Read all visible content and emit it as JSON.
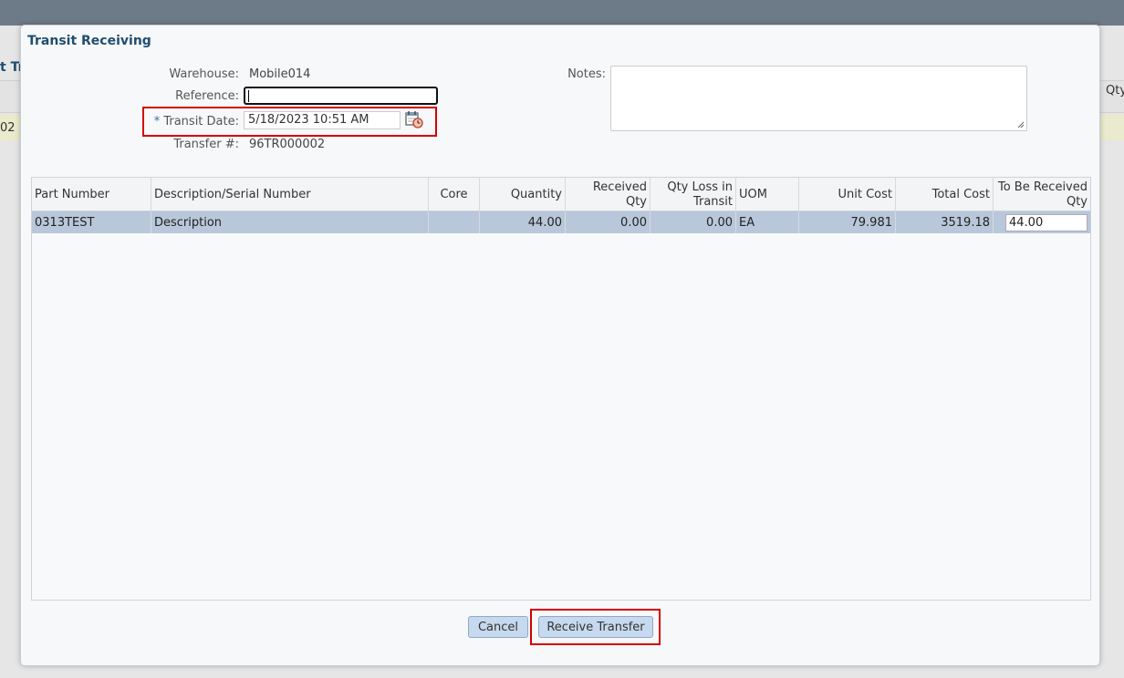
{
  "background": {
    "left_label_partial": "t Tr",
    "right_label_partial": "Qty",
    "row_partial": "02"
  },
  "dialog": {
    "title": "Transit Receiving",
    "fields": {
      "warehouse_label": "Warehouse:",
      "warehouse_value": "Mobile014",
      "reference_label": "Reference:",
      "reference_value": "",
      "transit_date_required_mark": "*",
      "transit_date_label": "Transit Date:",
      "transit_date_value": "5/18/2023 10:51 AM",
      "transfer_label": "Transfer #:",
      "transfer_value": "96TR000002",
      "notes_label": "Notes:",
      "notes_value": ""
    },
    "grid": {
      "columns": [
        "Part Number",
        "Description/Serial Number",
        "Core",
        "Quantity",
        "Received Qty",
        "Qty Loss in Transit",
        "UOM",
        "Unit Cost",
        "Total Cost",
        "To Be Received Qty"
      ],
      "rows": [
        {
          "part_number": "0313TEST",
          "description": "Description",
          "core": "",
          "quantity": "44.00",
          "received_qty": "0.00",
          "qty_loss": "0.00",
          "uom": "EA",
          "unit_cost": "79.981",
          "total_cost": "3519.18",
          "to_be_received": "44.00"
        }
      ]
    },
    "buttons": {
      "cancel": "Cancel",
      "receive": "Receive Transfer"
    }
  },
  "icons": {
    "calendar": "calendar-clock-icon"
  },
  "colors": {
    "title": "#1f4e6e",
    "highlight": "#d40000",
    "selected_row": "#b8c8da",
    "button": "#c6d9ee"
  }
}
